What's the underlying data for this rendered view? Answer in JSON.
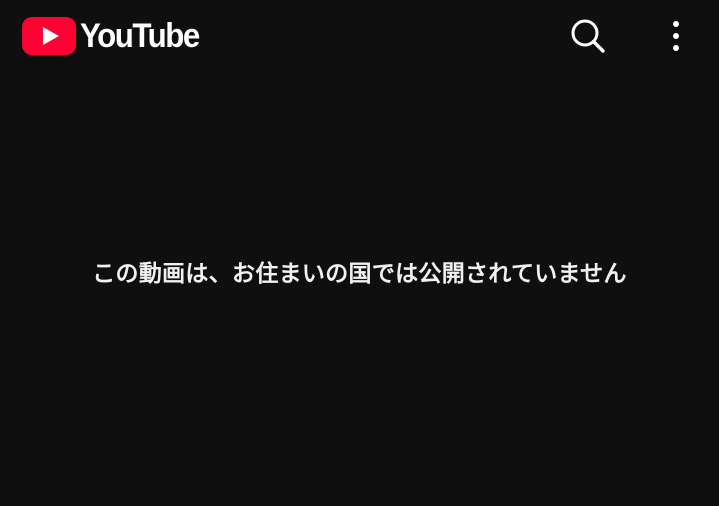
{
  "header": {
    "brand": "YouTube",
    "icons": {
      "logo": "youtube-play-icon",
      "search": "search-icon",
      "menu": "more-vertical-icon"
    }
  },
  "main": {
    "message": "この動画は、お住まいの国では公開されていません"
  },
  "colors": {
    "background": "#0f0f0f",
    "brand_red": "#ff0033",
    "text": "#ffffff"
  }
}
